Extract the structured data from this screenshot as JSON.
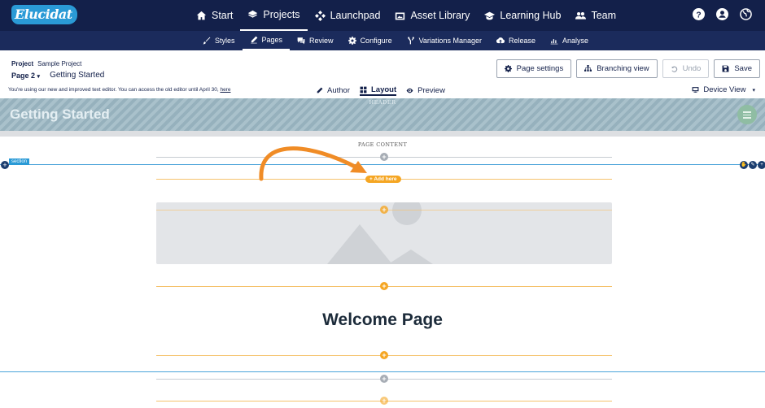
{
  "app": {
    "logo": "Elucidat"
  },
  "main_nav": [
    {
      "label": "Start",
      "icon": "home-icon"
    },
    {
      "label": "Projects",
      "icon": "layers-icon",
      "active": true
    },
    {
      "label": "Launchpad",
      "icon": "launchpad-icon"
    },
    {
      "label": "Asset Library",
      "icon": "image-library-icon"
    },
    {
      "label": "Learning Hub",
      "icon": "graduation-cap-icon"
    },
    {
      "label": "Team",
      "icon": "team-icon"
    }
  ],
  "top_icons": [
    "help-icon",
    "user-icon",
    "globe-icon"
  ],
  "sub_nav": [
    {
      "label": "Styles",
      "icon": "brush-icon"
    },
    {
      "label": "Pages",
      "icon": "pencil-icon",
      "active": true
    },
    {
      "label": "Review",
      "icon": "comments-icon"
    },
    {
      "label": "Configure",
      "icon": "cog-icon"
    },
    {
      "label": "Variations Manager",
      "icon": "fork-icon"
    },
    {
      "label": "Release",
      "icon": "cloud-upload-icon"
    },
    {
      "label": "Analyse",
      "icon": "bar-chart-icon"
    }
  ],
  "project": {
    "label": "Project",
    "name": "Sample Project",
    "page_label": "Page 2",
    "page_title": "Getting Started"
  },
  "editor_note": {
    "text": "You're using our new and improved text editor. You can access the old editor until April 30,",
    "link": "here"
  },
  "header_buttons": {
    "page_settings": "Page settings",
    "branching_view": "Branching view",
    "undo": "Undo",
    "save": "Save"
  },
  "mode_tabs": {
    "author": "Author",
    "layout": "Layout",
    "preview": "Preview",
    "active": "Layout"
  },
  "device_view": "Device View",
  "canvas": {
    "header_label": "HEADER",
    "header_title": "Getting Started",
    "page_content_label": "PAGE CONTENT",
    "section_label": "section",
    "add_here": "+ Add here",
    "welcome_title": "Welcome Page"
  },
  "colors": {
    "nav_dark": "#13204a",
    "nav_sub": "#1b2b5c",
    "accent_orange": "#f5a623",
    "section_blue": "#2a9ad6"
  }
}
